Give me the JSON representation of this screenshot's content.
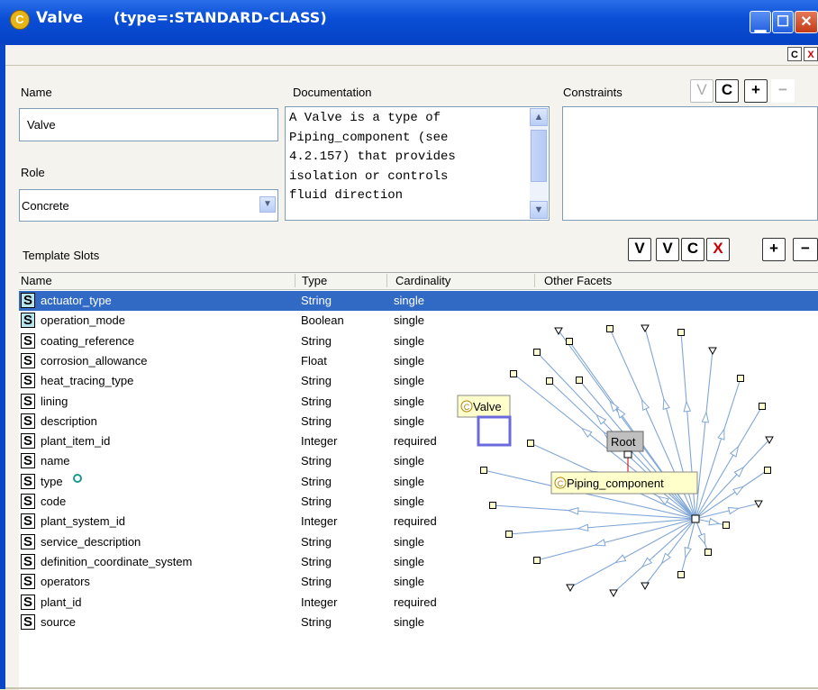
{
  "window": {
    "class_icon": "C",
    "title": "Valve",
    "type_label": "(type=:STANDARD-CLASS)"
  },
  "subbar": {
    "c_btn": "C",
    "x_btn": "X"
  },
  "name_label": "Name",
  "name_value": "Valve",
  "role_label": "Role",
  "role_value": "Concrete",
  "doc_label": "Documentation",
  "doc_text": "A Valve is a type of\nPiping_component (see\n4.2.157) that provides\nisolation or controls\nfluid direction",
  "constraints_label": "Constraints",
  "constraint_buttons": [
    "V",
    "C",
    "+",
    "−"
  ],
  "template_slots_label": "Template Slots",
  "slot_buttons": [
    "V",
    "V",
    "C",
    "X",
    "+",
    "−"
  ],
  "columns": [
    "Name",
    "Type",
    "Cardinality",
    "Other Facets"
  ],
  "slots": [
    {
      "name": "actuator_type",
      "type": "String",
      "cardinality": "single"
    },
    {
      "name": "operation_mode",
      "type": "Boolean",
      "cardinality": "single"
    },
    {
      "name": "coating_reference",
      "type": "String",
      "cardinality": "single"
    },
    {
      "name": "corrosion_allowance",
      "type": "Float",
      "cardinality": "single"
    },
    {
      "name": "heat_tracing_type",
      "type": "String",
      "cardinality": "single"
    },
    {
      "name": "lining",
      "type": "String",
      "cardinality": "single"
    },
    {
      "name": "description",
      "type": "String",
      "cardinality": "single"
    },
    {
      "name": "plant_item_id",
      "type": "Integer",
      "cardinality": "required"
    },
    {
      "name": "name",
      "type": "String",
      "cardinality": "single"
    },
    {
      "name": "type",
      "type": "String",
      "cardinality": "single"
    },
    {
      "name": "code",
      "type": "String",
      "cardinality": "single"
    },
    {
      "name": "plant_system_id",
      "type": "Integer",
      "cardinality": "required"
    },
    {
      "name": "service_description",
      "type": "String",
      "cardinality": "single"
    },
    {
      "name": "definition_coordinate_system",
      "type": "String",
      "cardinality": "single"
    },
    {
      "name": "operators",
      "type": "String",
      "cardinality": "single"
    },
    {
      "name": "plant_id",
      "type": "Integer",
      "cardinality": "required"
    },
    {
      "name": "source",
      "type": "String",
      "cardinality": "single"
    }
  ],
  "slot_icon": "S",
  "graph": {
    "valve_label": "Valve",
    "root_label": "Root",
    "piping_label": "Piping_component",
    "class_icon": "C"
  }
}
